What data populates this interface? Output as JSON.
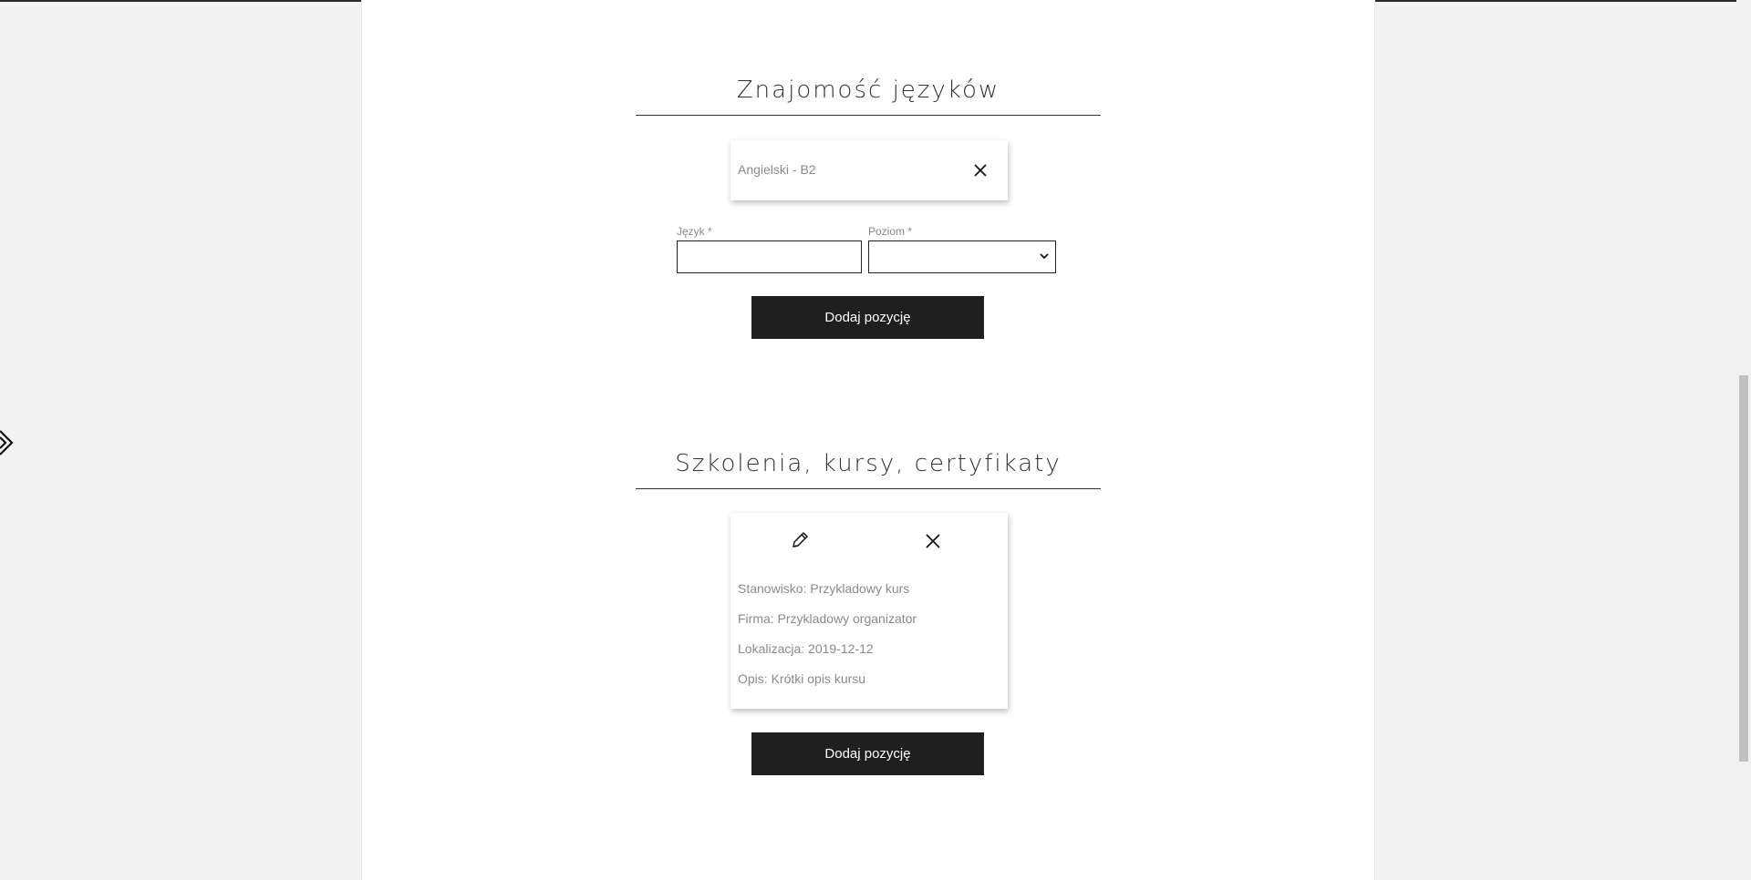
{
  "languages": {
    "title": "Znajomość języków",
    "entries": [
      {
        "text": "Angielski - B2"
      }
    ],
    "form": {
      "language_label": "Język *",
      "language_value": "",
      "level_label": "Poziom *",
      "level_value": ""
    },
    "add_button": "Dodaj pozycję"
  },
  "trainings": {
    "title": "Szkolenia, kursy, certyfikaty",
    "entries": [
      {
        "position": "Stanowisko: Przykladowy kurs",
        "company": "Firma: Przykladowy organizator",
        "location": "Lokalizacja: 2019-12-12",
        "description": "Opis: Krótki opis kursu"
      }
    ],
    "add_button": "Dodaj pozycję"
  },
  "icons": {
    "delete": "close-icon",
    "edit": "pencil-icon",
    "side_toggle": "double-chevron-right-icon",
    "select_arrow": "chevron-down-icon"
  }
}
